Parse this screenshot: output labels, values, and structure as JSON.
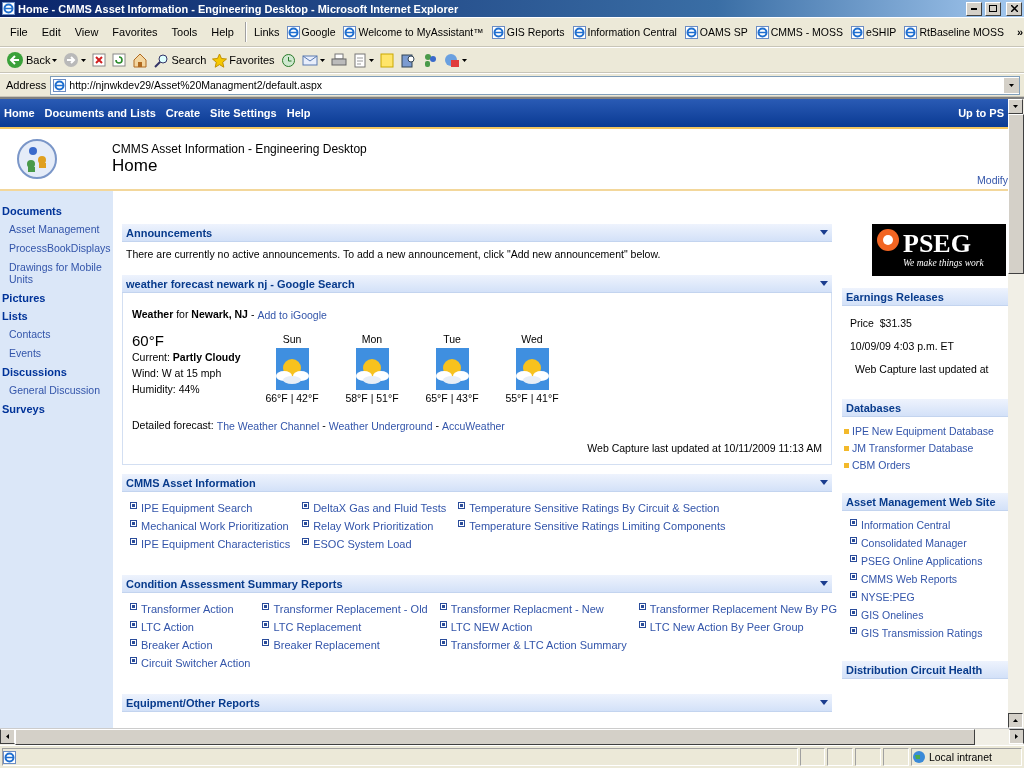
{
  "window": {
    "title": "Home - CMMS Asset Information - Engineering Desktop - Microsoft Internet Explorer"
  },
  "menu": [
    "File",
    "Edit",
    "View",
    "Favorites",
    "Tools",
    "Help"
  ],
  "links": {
    "label": "Links",
    "more": "»",
    "items": [
      "Google",
      "Welcome to MyAssistant™",
      "GIS Reports",
      "Information Central",
      "OAMS SP",
      "CMMS - MOSS",
      "eSHIP",
      "RtBaseline MOSS"
    ]
  },
  "toolbar": [
    {
      "kind": "back",
      "label": "Back",
      "dropdown": true
    },
    {
      "kind": "forward",
      "dropdown": true
    },
    {
      "kind": "stop",
      "dropdown": false
    },
    {
      "kind": "refresh",
      "dropdown": false
    },
    {
      "kind": "home",
      "dropdown": false
    },
    {
      "kind": "search",
      "label": "Search",
      "dropdown": false
    },
    {
      "kind": "favorites",
      "label": "Favorites",
      "dropdown": false
    },
    {
      "kind": "history",
      "dropdown": false
    },
    {
      "kind": "mail",
      "dropdown": true
    },
    {
      "kind": "print",
      "dropdown": false
    },
    {
      "kind": "edit",
      "dropdown": true
    },
    {
      "kind": "note",
      "dropdown": false
    },
    {
      "kind": "research",
      "dropdown": false
    },
    {
      "kind": "messenger",
      "dropdown": false
    },
    {
      "kind": "tool",
      "dropdown": true
    }
  ],
  "address": {
    "label": "Address",
    "value": "http://njnwkdev29/Asset%20Managment2/default.aspx"
  },
  "nav": {
    "items": [
      "Home",
      "Documents and Lists",
      "Create",
      "Site Settings",
      "Help"
    ],
    "right": "Up to PS"
  },
  "header": {
    "site": "CMMS Asset Information - Engineering Desktop",
    "page": "Home",
    "modify": "Modify"
  },
  "sidebar": [
    {
      "label": "Documents",
      "children": [
        {
          "label": "Asset Management"
        },
        {
          "label": "ProcessBookDisplays"
        },
        {
          "label": "Drawings for Mobile Units"
        }
      ]
    },
    {
      "label": "Pictures"
    },
    {
      "label": "Lists",
      "children": [
        {
          "label": "Contacts"
        },
        {
          "label": "Events"
        }
      ]
    },
    {
      "label": "Discussions",
      "children": [
        {
          "label": "General Discussion"
        }
      ]
    },
    {
      "label": "Surveys"
    }
  ],
  "web_parts": [
    {
      "kind": "text",
      "title": "Announcements",
      "text": "There are currently no active announcements. To add a new announcement, click \"Add new announcement\" below."
    },
    {
      "kind": "weather",
      "title": "weather forecast newark nj - Google Search",
      "heading": "**Weather** for **Newark, NJ** -",
      "add_link": "Add to iGoogle",
      "temp": "60°F",
      "current": "Current: **Partly Cloudy**",
      "wind": "Wind: W at 15 mph",
      "humidity": "Humidity: 44%",
      "days": [
        {
          "day": "Sun",
          "temps": "66°F | 42°F"
        },
        {
          "day": "Mon",
          "temps": "58°F | 51°F"
        },
        {
          "day": "Tue",
          "temps": "65°F | 43°F"
        },
        {
          "day": "Wed",
          "temps": "55°F | 41°F"
        }
      ],
      "forecast_label": "Detailed forecast:",
      "forecast_links": [
        "The Weather Channel",
        "Weather Underground",
        "AccuWeather"
      ],
      "forecast_separators": [
        "-",
        "-"
      ],
      "updated": "Web Capture last updated at 10/11/2009 11:13 AM"
    },
    {
      "kind": "links",
      "title": "CMMS Asset Information",
      "columns": [
        [
          "IPE Equipment Search",
          "Mechanical Work Prioritization",
          "IPE Equipment Characteristics"
        ],
        [
          "DeltaX Gas and Fluid Tests",
          "Relay Work Prioritization",
          "ESOC System Load"
        ],
        [
          "Temperature Sensitive Ratings By Circuit & Section",
          "Temperature Sensitive Ratings Limiting Components"
        ]
      ]
    },
    {
      "kind": "links",
      "title": "Condition Assessment Summary Reports",
      "columns": [
        [
          "Transformer Action",
          "LTC Action",
          "Breaker Action",
          "Circuit Switcher Action"
        ],
        [
          "Transformer Replacement - Old",
          "LTC Replacement",
          "Breaker Replacement"
        ],
        [
          "Transformer Replacment - New",
          "LTC NEW Action",
          "Transformer & LTC Action Summary"
        ],
        [
          "Transformer Replacement New By PG",
          "LTC New Action By Peer Group"
        ]
      ]
    },
    {
      "kind": "empty",
      "title": "Equipment/Other Reports"
    }
  ],
  "logo": {
    "name": "PSEG",
    "tagline": "We make things work"
  },
  "right_parts": [
    {
      "kind": "lines",
      "title": "Earnings Releases",
      "lines": [
        "Price  $31.35",
        "10/09/09 4:03 p.m. ET",
        "Web Capture last updated at"
      ]
    },
    {
      "kind": "squares",
      "title": "Databases",
      "items": [
        "IPE New Equipment Database",
        "JM Transformer Database",
        "CBM Orders"
      ]
    },
    {
      "kind": "bullets",
      "title": "Asset Management Web Site",
      "items": [
        "Information Central",
        "Consolidated Manager",
        "PSEG Online Applications",
        "CMMS Web Reports",
        "NYSE:PEG",
        "GIS Onelines",
        "GIS Transmission Ratings"
      ]
    },
    {
      "kind": "empty",
      "title": "Distribution Circuit Health"
    }
  ],
  "status": {
    "zone": "Local intranet"
  }
}
